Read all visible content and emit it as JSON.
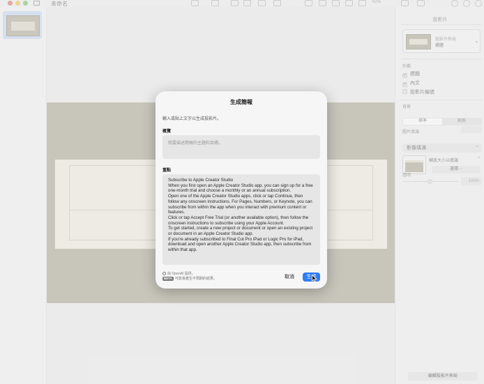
{
  "window": {
    "doc_title": "未命名",
    "zoom": "62%"
  },
  "inspector": {
    "title": "投影片",
    "layout_label": "投影片佈局",
    "layout_value": "標題",
    "appearance_label": "外觀",
    "checks": [
      {
        "label": "標題",
        "checked": true
      },
      {
        "label": "內文",
        "checked": true
      },
      {
        "label": "投影片編號",
        "checked": false
      }
    ],
    "background_label": "背景",
    "tabs": [
      "標準",
      "動態"
    ],
    "fill_label": "圖片填滿",
    "fill_popup": "影像填滿",
    "scale_popup": "縮放大小以填滿",
    "choose_button": "選擇⋯",
    "opacity_label": "透明",
    "opacity_value": "100%",
    "edit_layout_button": "編輯投影片佈局"
  },
  "dialog": {
    "title": "生成簡報",
    "instruction": "輸入或貼上文字以生成投影片。",
    "summary_label": "概覽",
    "summary_placeholder": "簡要描述簡報的主題和目標。",
    "points_label": "重點",
    "points": [
      "Subscribe to Apple Creator Studio",
      "When you first open an Apple Creator Studio app, you can sign up for a free one-month trial and choose a monthly or an annual subscription.",
      "Open one of the Apple Creator Studio apps, click or tap Continue, then follow any onscreen instructions. For Pages, Numbers, or Keynote, you can subscribe from within the app when you interact with premium content or features.",
      "Click or tap Accept Free Trial (or another available option), then follow the onscreen instructions to subscribe using your Apple Account.",
      "To get started, create a new project or document or open an existing project or document in an Apple Creator Studio app.",
      "If you're already subscribed to Final Cut Pro iPad or Logic Pro for iPad, download and open another Apple Creator Studio app, then subscribe from within that app."
    ],
    "footer_line1": "由 OpenAI 提供。",
    "beta_badge": "BETA",
    "footer_line2": "可能會產生不預期的結果。",
    "cancel_label": "取消",
    "generate_label": "生成"
  }
}
